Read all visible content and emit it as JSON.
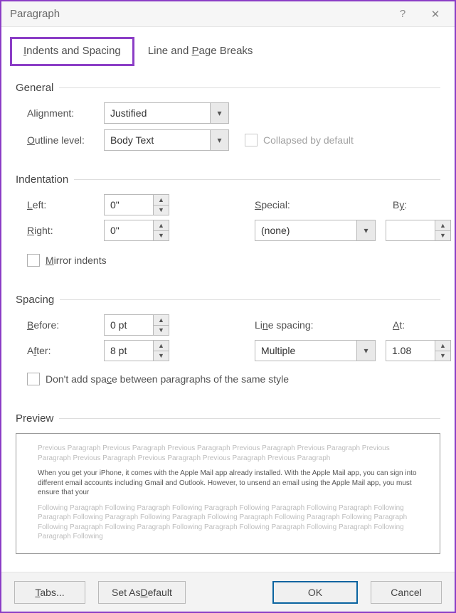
{
  "window": {
    "title": "Paragraph",
    "help": "?",
    "close": "✕"
  },
  "tabs": {
    "indents": "Indents and Spacing",
    "lineBreaks": "Line and Page Breaks"
  },
  "general": {
    "heading": "General",
    "alignment_label": "Alignment:",
    "alignment_value": "Justified",
    "outline_label": "Outline level:",
    "outline_value": "Body Text",
    "collapsed_label": "Collapsed by default"
  },
  "indentation": {
    "heading": "Indentation",
    "left_label": "Left:",
    "left_value": "0\"",
    "right_label": "Right:",
    "right_value": "0\"",
    "special_label": "Special:",
    "special_value": "(none)",
    "by_label": "By:",
    "by_value": "",
    "mirror_label": "Mirror indents"
  },
  "spacing": {
    "heading": "Spacing",
    "before_label": "Before:",
    "before_value": "0 pt",
    "after_label": "After:",
    "after_value": "8 pt",
    "line_label": "Line spacing:",
    "line_value": "Multiple",
    "at_label": "At:",
    "at_value": "1.08",
    "dont_add_label": "Don't add space between paragraphs of the same style"
  },
  "preview": {
    "heading": "Preview",
    "prev_text": "Previous Paragraph Previous Paragraph Previous Paragraph Previous Paragraph Previous Paragraph Previous Paragraph Previous Paragraph Previous Paragraph Previous Paragraph Previous Paragraph",
    "body_text": "When you get your iPhone, it comes with the Apple Mail app already installed. With the Apple Mail app, you can sign into different email accounts including Gmail and Outlook. However, to unsend an email using the Apple Mail app, you must ensure that your",
    "next_text": "Following Paragraph Following Paragraph Following Paragraph Following Paragraph Following Paragraph Following Paragraph Following Paragraph Following Paragraph Following Paragraph Following Paragraph Following Paragraph Following Paragraph Following Paragraph Following Paragraph Following Paragraph Following Paragraph Following Paragraph Following"
  },
  "footer": {
    "tabs": "Tabs...",
    "set_default": "Set As Default",
    "ok": "OK",
    "cancel": "Cancel"
  }
}
